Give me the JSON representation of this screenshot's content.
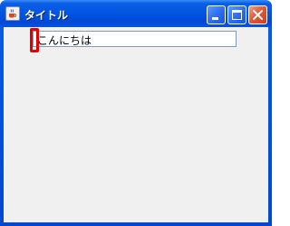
{
  "window": {
    "title": "タイトル",
    "app_icon": "java-coffee-cup-icon",
    "buttons": {
      "minimize": "minimize-icon",
      "maximize": "maximize-icon",
      "close": "close-icon"
    }
  },
  "text_field": {
    "value": "こんにちは"
  },
  "colors": {
    "titlebar": "#0054e3",
    "close_button": "#e2593a",
    "highlight": "#e20000",
    "client_background": "#f0f0f0"
  }
}
